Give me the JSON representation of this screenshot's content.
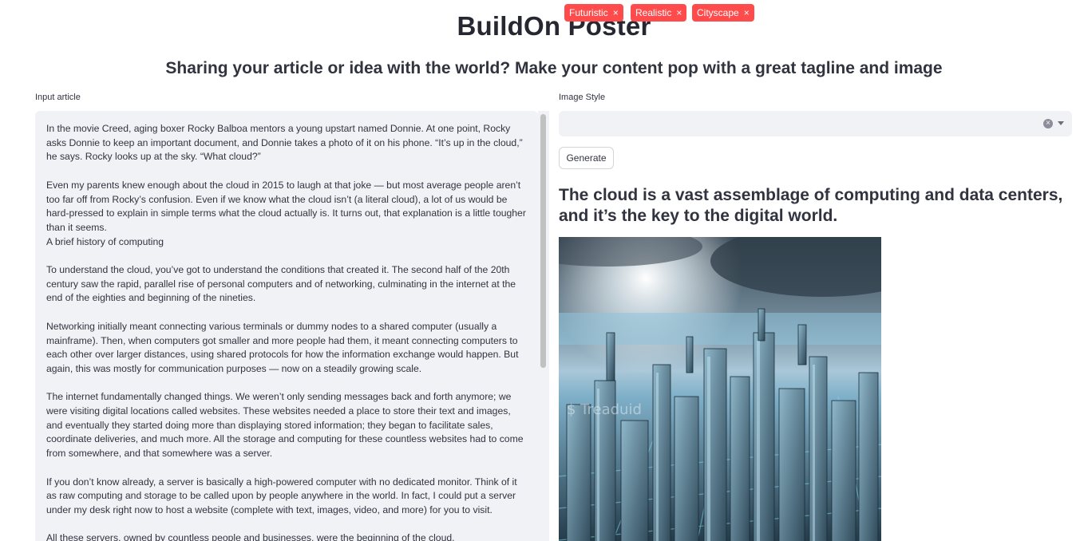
{
  "header": {
    "title": "BuildOn Poster",
    "subtitle": "Sharing your article or idea with the world? Make your content pop with a great tagline and image"
  },
  "input": {
    "label": "Input article",
    "text": "In the movie Creed, aging boxer Rocky Balboa mentors a young upstart named Donnie. At one point, Rocky asks Donnie to keep an important document, and Donnie takes a photo of it on his phone. “It’s up in the cloud,” he says. Rocky looks up at the sky. “What cloud?”\n\nEven my parents knew enough about the cloud in 2015 to laugh at that joke — but most average people aren’t too far off from Rocky’s confusion. Even if we know what the cloud isn’t (a literal cloud), a lot of us would be hard-pressed to explain in simple terms what the cloud actually is. It turns out, that explanation is a little tougher than it seems.\nA brief history of computing\n\nTo understand the cloud, you’ve got to understand the conditions that created it. The second half of the 20th century saw the rapid, parallel rise of personal computers and of networking, culminating in the internet at the end of the eighties and beginning of the nineties.\n\nNetworking initially meant connecting various terminals or dummy nodes to a shared computer (usually a mainframe). Then, when computers got smaller and more people had them, it meant connecting computers to each other over larger distances, using shared protocols for how the information exchange would happen. But again, this was mostly for communication purposes — now on a steadily growing scale.\n\nThe internet fundamentally changed things. We weren’t only sending messages back and forth anymore; we were visiting digital locations called websites. These websites needed a place to store their text and images, and eventually they started doing more than displaying stored information; they began to facilitate sales, coordinate deliveries, and much more. All the storage and computing for these countless websites had to come from somewhere, and that somewhere was a server.\n\nIf you don’t know already, a server is basically a high-powered computer with no dedicated monitor. Think of it as raw computing and storage to be called upon by people anywhere in the world. In fact, I could put a server under my desk right now to host a website (complete with text, images, video, and more) for you to visit.\n\nAll these servers, owned by countless people and businesses, were the beginning of the cloud."
  },
  "style": {
    "label": "Image Style",
    "tags": [
      "Futuristic",
      "Realistic",
      "Cityscape"
    ],
    "remove_glyph": "×",
    "clear_glyph": "×"
  },
  "actions": {
    "generate_label": "Generate"
  },
  "output": {
    "tagline": "The cloud is a vast assemblage of computing and data centers, and it’s the key to the digital world.",
    "image_watermark": "$ Treaduid"
  },
  "colors": {
    "accent": "#ff4b4b",
    "input_bg": "#f0f2f6",
    "text": "#31333f"
  },
  "icons": {
    "tag_remove": "close-icon",
    "clear": "clear-all-icon",
    "dropdown": "chevron-down-icon"
  }
}
